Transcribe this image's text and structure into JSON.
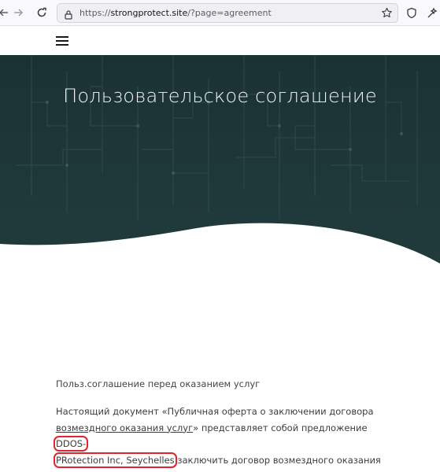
{
  "browser": {
    "url_scheme": "https://",
    "url_host": "strongprotect.site",
    "url_path": "/?page=agreement",
    "icons": [
      "forward-arrow-icon",
      "reload-icon",
      "lock-icon",
      "bookmark-star-icon",
      "shield-icon",
      "extensions-icon"
    ]
  },
  "page": {
    "title": "Пользовательское соглашение",
    "subhead": "Польз.соглашение перед оказанием услуг",
    "para_part1": "Настоящий документ «Публичная оферта о заключении договора ",
    "para_link": "возмездного оказания услуг",
    "para_part2": "» представляет собой предложение ",
    "para_company1": "DDOS-",
    "para_company2": "PRotection Inc, Seychelles",
    "para_part3": " заключить договор возмездного оказания услуг на изложенных ниже условиях."
  },
  "colors": {
    "hero_bg": "#1d3537",
    "highlight": "#e0242f"
  }
}
